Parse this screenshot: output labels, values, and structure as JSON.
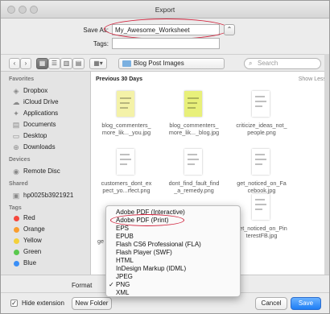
{
  "window": {
    "title": "Export"
  },
  "save_as": {
    "label": "Save As:",
    "value": "My_Awesome_Worksheet"
  },
  "tags": {
    "label": "Tags:"
  },
  "toolbar": {
    "back": "‹",
    "forward": "›",
    "view_icons": "▦",
    "view_list": "☰",
    "view_columns": "▥",
    "view_gallery": "▤",
    "arrange": "▦▾",
    "location": "Blog Post Images",
    "search_placeholder": "Search"
  },
  "sidebar": {
    "favorites_header": "Favorites",
    "favorites": [
      {
        "label": "Dropbox",
        "icon": "box-icon"
      },
      {
        "label": "iCloud Drive",
        "icon": "cloud-icon"
      },
      {
        "label": "Applications",
        "icon": "apps-icon"
      },
      {
        "label": "Documents",
        "icon": "doc-icon"
      },
      {
        "label": "Desktop",
        "icon": "desktop-icon"
      },
      {
        "label": "Downloads",
        "icon": "download-icon"
      }
    ],
    "devices_header": "Devices",
    "devices": [
      {
        "label": "Remote Disc",
        "icon": "disc-icon"
      }
    ],
    "shared_header": "Shared",
    "shared": [
      {
        "label": "hp0025b3921921",
        "icon": "computer-icon"
      }
    ],
    "tags_header": "Tags",
    "tags": [
      {
        "label": "Red",
        "color": "#f5483d"
      },
      {
        "label": "Orange",
        "color": "#f99d2f"
      },
      {
        "label": "Yellow",
        "color": "#f4d03a"
      },
      {
        "label": "Green",
        "color": "#5ac84d"
      },
      {
        "label": "Blue",
        "color": "#3a8ff7"
      }
    ]
  },
  "content": {
    "section": "Previous 30 Days",
    "show_less": "Show Less",
    "files": [
      {
        "line1": "blog_commenters_",
        "line2": "more_lik..._you.jpg",
        "color": "#f4f2a8"
      },
      {
        "line1": "blog_commenters_",
        "line2": "more_lik..._blog.jpg",
        "color": "#e8f07a"
      },
      {
        "line1": "criticize_ideas_not_",
        "line2": "people.png",
        "color": "#f2f2f2"
      },
      {
        "line1": "customers_dont_ex",
        "line2": "pect_yo...rfect.png",
        "color": "#fbfbfb"
      },
      {
        "line1": "dont_find_fault_find",
        "line2": "_a_remedy.png",
        "color": "#fbfbfb"
      },
      {
        "line1": "get_noticed_on_Fa",
        "line2": "cebook.jpg",
        "color": "#f6f6f6"
      },
      {
        "line1": "ge",
        "line2": "",
        "color": "#fbfbfb"
      },
      {
        "line1": "get_noticed_on_Pin",
        "line2": "terestFB.jpg",
        "color": "#fbfbfb"
      }
    ]
  },
  "format": {
    "label": "Format",
    "options": [
      "Adobe PDF (Interactive)",
      "Adobe PDF (Print)",
      "EPS",
      "EPUB",
      "Flash CS6 Professional (FLA)",
      "Flash Player (SWF)",
      "HTML",
      "InDesign Markup (IDML)",
      "JPEG",
      "PNG",
      "XML"
    ],
    "selected": "PNG",
    "check": "✓"
  },
  "bottom": {
    "hide_extension": "Hide extension",
    "hide_extension_checked": "✓",
    "new_folder": "New Folder",
    "cancel": "Cancel",
    "save": "Save"
  }
}
